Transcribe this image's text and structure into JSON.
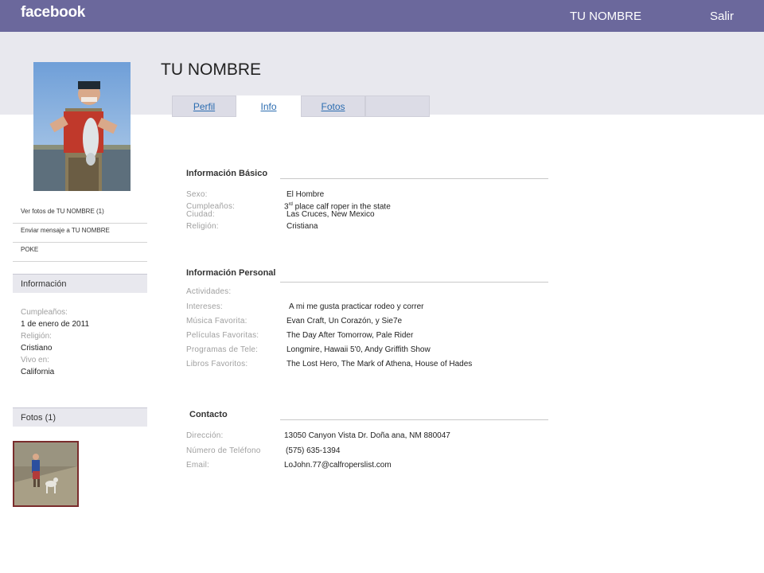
{
  "topbar": {
    "logo": "facebook",
    "user_name": "TU NOMBRE",
    "logout": "Salir"
  },
  "profile": {
    "name": "TU NOMBRE"
  },
  "tabs": [
    {
      "label": "Perfil"
    },
    {
      "label": "Info"
    },
    {
      "label": "Fotos"
    },
    {
      "label": ""
    }
  ],
  "sidebar": {
    "links": [
      "Ver fotos de TU NOMBRE (1)",
      "Enviar mensaje a TU NOMBRE",
      "POKE"
    ],
    "info_header": "Información",
    "info": [
      {
        "label": "Cumpleaños:",
        "value": "1 de enero de 2011"
      },
      {
        "label": "Religión:",
        "value": "Cristiano"
      },
      {
        "label": "Vivo en:",
        "value": "California"
      }
    ],
    "fotos_header": "Fotos (1)"
  },
  "basic": {
    "title": "Información Básico",
    "rows": [
      {
        "label": "Sexo:",
        "value": "El Hombre"
      },
      {
        "label": "Cumpleaños:",
        "value_prefix": "3",
        "value_sup": "rd",
        "value_suffix": " place calf roper in the state"
      },
      {
        "label": "Ciudad:",
        "value": "Las Cruces, New Mexico"
      },
      {
        "label": "Religión:",
        "value": "Cristiana"
      }
    ]
  },
  "personal": {
    "title": "Información Personal",
    "rows": [
      {
        "label": "Actividades:",
        "value": ""
      },
      {
        "label": "Intereses:",
        "value": "A mi me gusta practicar rodeo y correr"
      },
      {
        "label": "Música Favorita:",
        "value": "Evan Craft, Un Corazón, y Sie7e"
      },
      {
        "label": "Películas Favoritas:",
        "value": "The Day After Tomorrow, Pale Rider"
      },
      {
        "label": "Programas de Tele:",
        "value": "Longmire, Hawaii 5'0, Andy Griffith Show"
      },
      {
        "label": "Libros Favoritos:",
        "value": "The Lost Hero, The Mark of Athena, House of Hades"
      }
    ]
  },
  "contact": {
    "title": "Contacto",
    "rows": [
      {
        "label": "Dirección:",
        "value": "13050 Canyon Vista Dr. Doña ana, NM 880047"
      },
      {
        "label": "Número de Teléfono",
        "value": "(575) 635-1394"
      },
      {
        "label": "Email:",
        "value": "LoJohn.77@calfroperslist.com"
      }
    ]
  }
}
